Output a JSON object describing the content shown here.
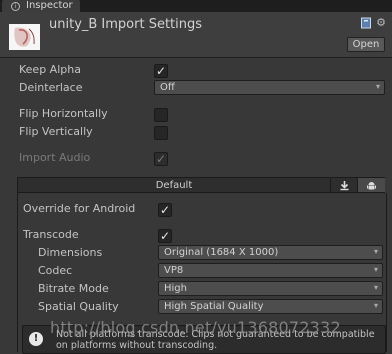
{
  "tab": {
    "label": "Inspector",
    "icon": "info-icon"
  },
  "header": {
    "title": "unity_B Import Settings",
    "open_label": "Open",
    "icons": [
      "book-icon",
      "gear-icon"
    ]
  },
  "settings": {
    "keep_alpha": {
      "label": "Keep Alpha",
      "checked": true
    },
    "deinterlace": {
      "label": "Deinterlace",
      "value": "Off"
    },
    "flip_horizontally": {
      "label": "Flip Horizontally",
      "checked": false
    },
    "flip_vertically": {
      "label": "Flip Vertically",
      "checked": false
    },
    "import_audio": {
      "label": "Import Audio",
      "checked": true,
      "disabled": true
    }
  },
  "platform": {
    "default_label": "Default",
    "tabs": [
      "download-icon",
      "android-icon"
    ],
    "active_tab": "android-icon"
  },
  "android": {
    "override": {
      "label": "Override for Android",
      "checked": true
    },
    "transcode": {
      "label": "Transcode",
      "checked": true
    },
    "dimensions": {
      "label": "Dimensions",
      "value": "Original (1684 X 1000)"
    },
    "codec": {
      "label": "Codec",
      "value": "VP8"
    },
    "bitrate_mode": {
      "label": "Bitrate Mode",
      "value": "High"
    },
    "spatial_quality": {
      "label": "Spatial Quality",
      "value": "High Spatial Quality"
    }
  },
  "help": {
    "message": "Not all platforms transcode. Clips not guaranteed to be compatible on platforms without transcoding."
  },
  "watermark": "http://blog.csdn.net/yu1368072332"
}
